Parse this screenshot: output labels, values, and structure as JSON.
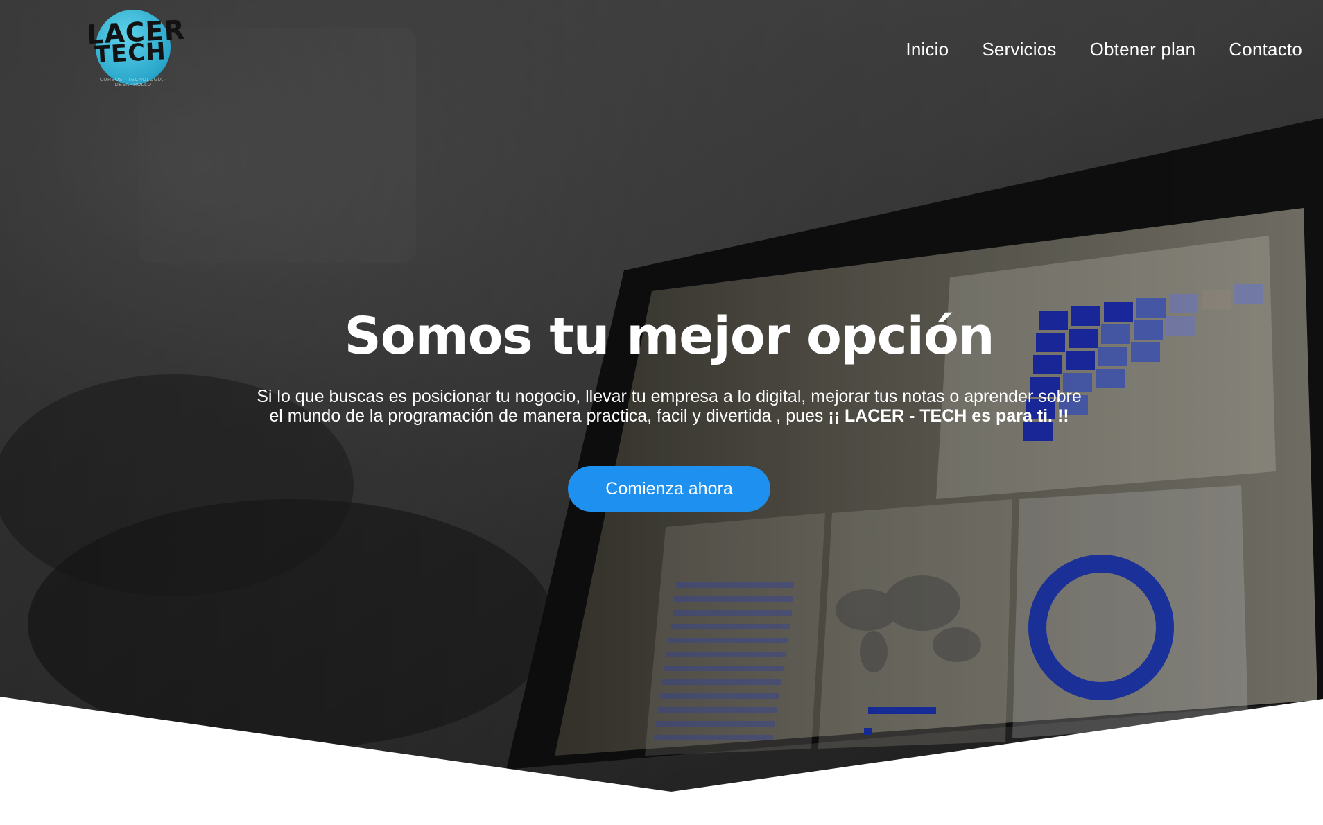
{
  "brand": {
    "logo_line1": "LACER",
    "logo_line2": "TECH",
    "logo_tagline": "CURSOS · TECNOLOGÍA · DESARROLLO"
  },
  "nav": {
    "items": [
      {
        "label": "Inicio"
      },
      {
        "label": "Servicios"
      },
      {
        "label": "Obtener plan"
      },
      {
        "label": "Contacto"
      }
    ]
  },
  "hero": {
    "title": "Somos tu mejor opción",
    "description": "Si lo que buscas es posicionar tu nogocio, llevar tu empresa a lo digital, mejorar tus notas o aprender sobre el mundo de la programación de manera practica, facil y divertida , pues ",
    "description_strong": "¡¡ LACER - TECH es para ti. !!",
    "cta_label": "Comienza ahora"
  },
  "colors": {
    "cta_background": "#1e90f0",
    "logo_circle": "#2aa7cb",
    "page_background": "#ffffff"
  }
}
